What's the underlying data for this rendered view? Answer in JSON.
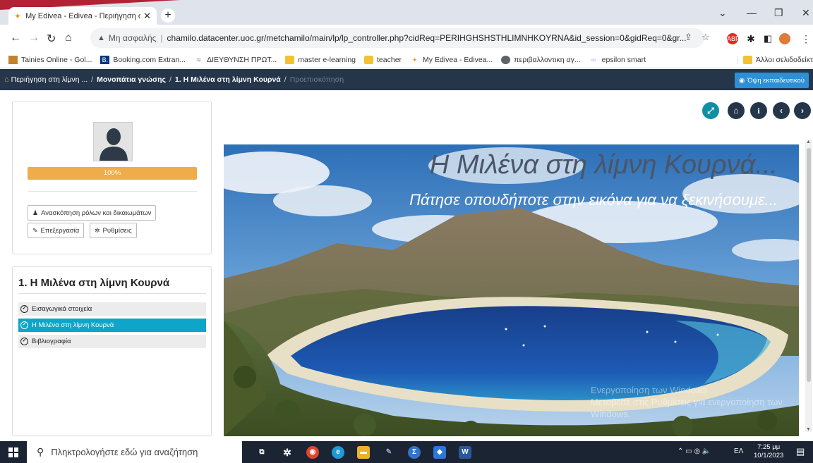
{
  "browser": {
    "tab_title": "My Edivea - Edivea - Περιήγηση σ",
    "new_tab_label": "+",
    "address": {
      "security_label": "Μη ασφαλής",
      "url": "chamilo.datacenter.uoc.gr/metchamilo/main/lp/lp_controller.php?cidReq=PERIHGHSHSTHLIMNHKOYRNA&id_session=0&gidReq=0&gr..."
    },
    "bookmarks": [
      {
        "label": "Tainies Online - Gol...",
        "icon": "film-icon",
        "color": "#c2832d"
      },
      {
        "label": "Booking.com Extran...",
        "icon": "booking-icon",
        "color": "#003580"
      },
      {
        "label": "ΔΙΕΥΘΥΝΣΗ ΠΡΩΤ...",
        "icon": "site-icon",
        "color": "#9aa0a6"
      },
      {
        "label": "master e-learning",
        "icon": "folder-icon",
        "color": "#f2c232"
      },
      {
        "label": "teacher",
        "icon": "folder-icon",
        "color": "#f2c232"
      },
      {
        "label": "My Edivea - Edivea...",
        "icon": "edivea-icon",
        "color": "#e0a01a"
      },
      {
        "label": "περιβαλλοντικη αγ...",
        "icon": "globe-icon",
        "color": "#5f6368"
      },
      {
        "label": "epsilon smart",
        "icon": "link-icon",
        "color": "#8ab4f8"
      }
    ],
    "other_bookmarks": "Άλλοι σελιδοδείκτε"
  },
  "appbar": {
    "crumbs": [
      {
        "label": "Περιήγηση στη λίμνη ...",
        "style": "normal"
      },
      {
        "label": "Μονοπάτια γνώσης",
        "style": "bold"
      },
      {
        "label": "1. Η Μιλένα στη λίμνη Κουρνά",
        "style": "bold"
      },
      {
        "label": "Προεπισκόπηση",
        "style": "dim"
      }
    ],
    "teacher_view_label": "Όψη εκπαιδευτικού"
  },
  "profile": {
    "progress_label": "100%",
    "progress_value": 1.0,
    "roles_button": "Ανασκόπηση ρόλων και δικαιωμάτων",
    "edit_button": "Επεξεργασία",
    "settings_button": "Ρυθμίσεις"
  },
  "toc": {
    "title": "1. Η Μιλένα στη λίμνη Κουρνά",
    "items": [
      {
        "label": "Εισαγωγικά στοιχεία",
        "active": false
      },
      {
        "label": "Η Μιλένα στη λίμνη Κουρνά",
        "active": true
      },
      {
        "label": "Βιβλιογραφία",
        "active": false
      }
    ]
  },
  "stage": {
    "headline": "Η Μιλένα στη λίμνη Κουρνά...",
    "subheadline": "Πάτησε οπουδήποτε στην εικόνα για να ξεκινήσουμε...",
    "watermark_line1": "Ενεργοποίηση των Windows",
    "watermark_line2": "Μεταβείτε στις Ρυθμίσεις για ενεργοποίηση των",
    "watermark_line3": "Windows."
  },
  "taskbar": {
    "search_placeholder": "Πληκτρολογήστε εδώ για αναζήτηση",
    "language": "ΕΛ",
    "time": "7:25 μμ",
    "date": "10/1/2023"
  }
}
